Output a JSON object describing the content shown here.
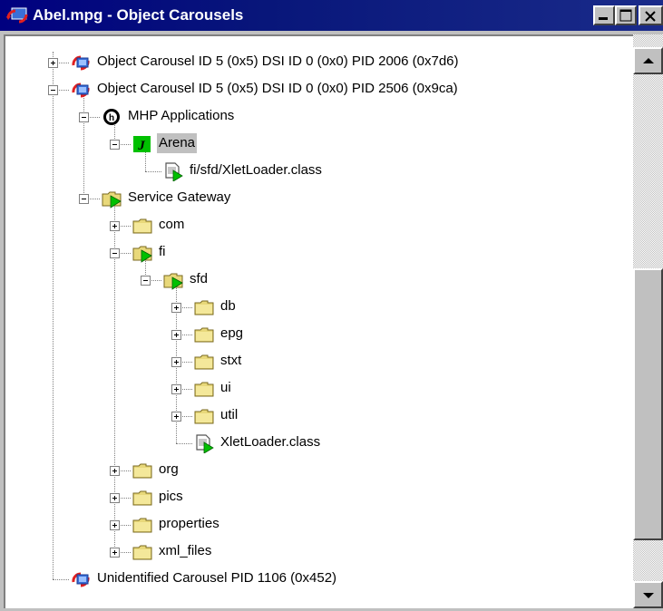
{
  "window": {
    "title": "Abel.mpg - Object Carousels"
  },
  "title_buttons": {
    "minimize": "minimize-icon",
    "maximize": "maximize-icon",
    "close": "close-icon"
  },
  "scrollbar": {
    "up": "scroll-up-arrow-icon",
    "down": "scroll-down-arrow-icon"
  },
  "tree": {
    "rows": [
      {
        "label": "Object Carousel ID 5 (0x5) DSI ID 0 (0x0) PID 2006 (0x7d6)",
        "icon": "carousel-icon",
        "state": "collapsed"
      },
      {
        "label": "Object Carousel ID 5 (0x5) DSI ID 0 (0x0) PID 2506 (0x9ca)",
        "icon": "carousel-icon",
        "state": "expanded"
      },
      {
        "label": "MHP Applications",
        "icon": "mhp-icon",
        "state": "expanded"
      },
      {
        "label": "Arena",
        "icon": "java-app-icon",
        "state": "expanded",
        "selected": true
      },
      {
        "label": "fi/sfd/XletLoader.class",
        "icon": "class-file-icon"
      },
      {
        "label": "Service Gateway",
        "icon": "gateway-folder-icon",
        "state": "expanded"
      },
      {
        "label": "com",
        "icon": "folder-icon",
        "state": "collapsed"
      },
      {
        "label": "fi",
        "icon": "open-folder-icon",
        "state": "expanded"
      },
      {
        "label": "sfd",
        "icon": "open-folder-icon",
        "state": "expanded"
      },
      {
        "label": "db",
        "icon": "folder-icon",
        "state": "collapsed"
      },
      {
        "label": "epg",
        "icon": "folder-icon",
        "state": "collapsed"
      },
      {
        "label": "stxt",
        "icon": "folder-icon",
        "state": "collapsed"
      },
      {
        "label": "ui",
        "icon": "folder-icon",
        "state": "collapsed"
      },
      {
        "label": "util",
        "icon": "folder-icon",
        "state": "collapsed"
      },
      {
        "label": "XletLoader.class",
        "icon": "class-file-icon"
      },
      {
        "label": "org",
        "icon": "folder-icon",
        "state": "collapsed"
      },
      {
        "label": "pics",
        "icon": "folder-icon",
        "state": "collapsed"
      },
      {
        "label": "properties",
        "icon": "folder-icon",
        "state": "collapsed"
      },
      {
        "label": "xml_files",
        "icon": "folder-icon",
        "state": "collapsed"
      },
      {
        "label": "Unidentified Carousel  PID 1106 (0x452)",
        "icon": "carousel-icon"
      }
    ]
  },
  "colors": {
    "titlebar": "#000080",
    "folder": "#e8d87a",
    "selection": "#c0c0c0",
    "play_green": "#00c000"
  }
}
